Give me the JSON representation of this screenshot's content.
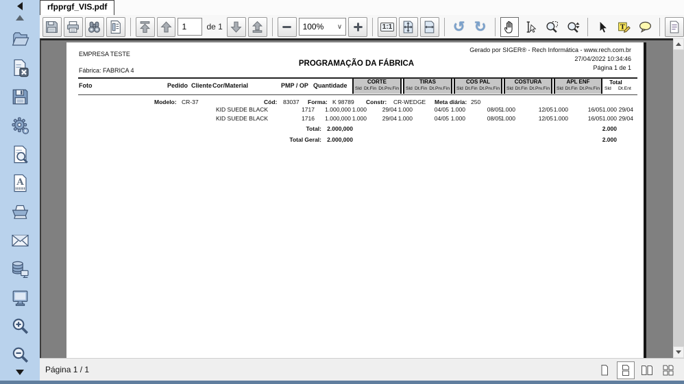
{
  "tab": {
    "title": "rfpprgf_VIS.pdf"
  },
  "toolbar": {
    "page_number": "1",
    "page_count_label": "de 1",
    "zoom_value": "100%",
    "one_to_one": "1:1",
    "rotate_ccw_glyph": "↺",
    "rotate_cw_glyph": "↻",
    "chevron_down_glyph": "∨"
  },
  "icons": {
    "sidebar": [
      "open-folder-icon",
      "close-document-icon",
      "save-icon",
      "settings-gear-icon",
      "preview-document-icon",
      "pdf-icon",
      "print-icon",
      "email-icon",
      "export-data-icon",
      "screen-icon",
      "zoom-in-icon",
      "zoom-out-icon"
    ],
    "toolbar": [
      "save-icon",
      "print-icon",
      "search-binoculars-icon",
      "report-structure-icon",
      "first-page-icon",
      "prev-page-icon",
      "next-page-icon",
      "last-page-icon",
      "zoom-out-icon",
      "zoom-in-icon",
      "actual-size-icon",
      "fit-page-icon",
      "fit-width-icon",
      "rotate-ccw-icon",
      "rotate-cw-icon",
      "hand-tool-icon",
      "text-select-icon",
      "zoom-marquee-icon",
      "zoom-dynamic-icon",
      "cursor-icon",
      "text-annotation-icon",
      "note-icon",
      "doc-properties-icon"
    ],
    "statusbar": [
      "single-page-icon",
      "continuous-icon",
      "facing-pages-icon",
      "tiled-pages-icon"
    ]
  },
  "report": {
    "company": "EMPRESA TESTE",
    "factory": "Fábrica: FABRICA 4",
    "title": "PROGRAMAÇÃO DA FÁBRICA",
    "generated_by": "Gerado por SIGER® - Rech Informática - www.rech.com.br",
    "generated_at": "27/04/2022 10:34:46",
    "page_info": "Página 1 de 1",
    "header": {
      "foto": "Foto",
      "pedido": "Pedido",
      "cliente": "Cliente",
      "cor_material": "Cor/Material",
      "pmp_op": "PMP  /  OP",
      "quantidade": "Quantidade",
      "groups": [
        {
          "name": "CORTE",
          "sub": [
            "Sld",
            "Dt.Fin",
            "Dt.Prv.Fin"
          ]
        },
        {
          "name": "TIRAS",
          "sub": [
            "Sld",
            "Dt.Fin",
            "Dt.Prv.Fin"
          ]
        },
        {
          "name": "COS PAL",
          "sub": [
            "Sld",
            "Dt.Fin",
            "Dt.Prv.Fin"
          ]
        },
        {
          "name": "COSTURA",
          "sub": [
            "Sld",
            "Dt.Fin",
            "Dt.Prv.Fin"
          ]
        },
        {
          "name": "APL ENF",
          "sub": [
            "Sld",
            "Dt.Fin",
            "Dt.Prv.Fin"
          ]
        }
      ],
      "total_group": {
        "name": "Total",
        "sub": [
          "Sld",
          "Dt.Ent"
        ]
      }
    },
    "model_line": {
      "modelo_label": "Modelo:",
      "modelo": "CR-37",
      "cod_label": "Cód:",
      "cod": "83037",
      "forma_label": "Forma:",
      "forma": "K 98789",
      "constr_label": "Constr:",
      "constr": "CR-WEDGE",
      "meta_label": "Meta diária:",
      "meta": "250"
    },
    "rows": [
      {
        "material": "KID SUEDE BLACK",
        "op": "1717",
        "qty": "1.000,000",
        "corte_sld": "1.000",
        "corte_prv": "29/04",
        "tiras_sld": "1.000",
        "tiras_prv": "04/05",
        "cospal_sld": "1.000",
        "cospal_prv": "08/05",
        "costura_sld": "1.000",
        "costura_prv": "12/05",
        "aplenf_sld": "1.000",
        "aplenf_prv": "16/05",
        "total_sld": "1.000",
        "total_ent": "29/04"
      },
      {
        "material": "KID SUEDE BLACK",
        "op": "1716",
        "qty": "1.000,000",
        "corte_sld": "1.000",
        "corte_prv": "29/04",
        "tiras_sld": "1.000",
        "tiras_prv": "04/05",
        "cospal_sld": "1.000",
        "cospal_prv": "08/05",
        "costura_sld": "1.000",
        "costura_prv": "12/05",
        "aplenf_sld": "1.000",
        "aplenf_prv": "16/05",
        "total_sld": "1.000",
        "total_ent": "29/04"
      }
    ],
    "totals": {
      "total_label": "Total:",
      "total_qty": "2.000,000",
      "total_sld": "2.000",
      "geral_label": "Total Geral:",
      "geral_qty": "2.000,000",
      "geral_sld": "2.000"
    }
  },
  "statusbar": {
    "page_label": "Página 1 / 1"
  },
  "colors": {
    "sidebar": "#b9d2ec",
    "viewport": "#808080",
    "group_header": "#c6c6c6",
    "bottom_strip": "#607e9e"
  }
}
